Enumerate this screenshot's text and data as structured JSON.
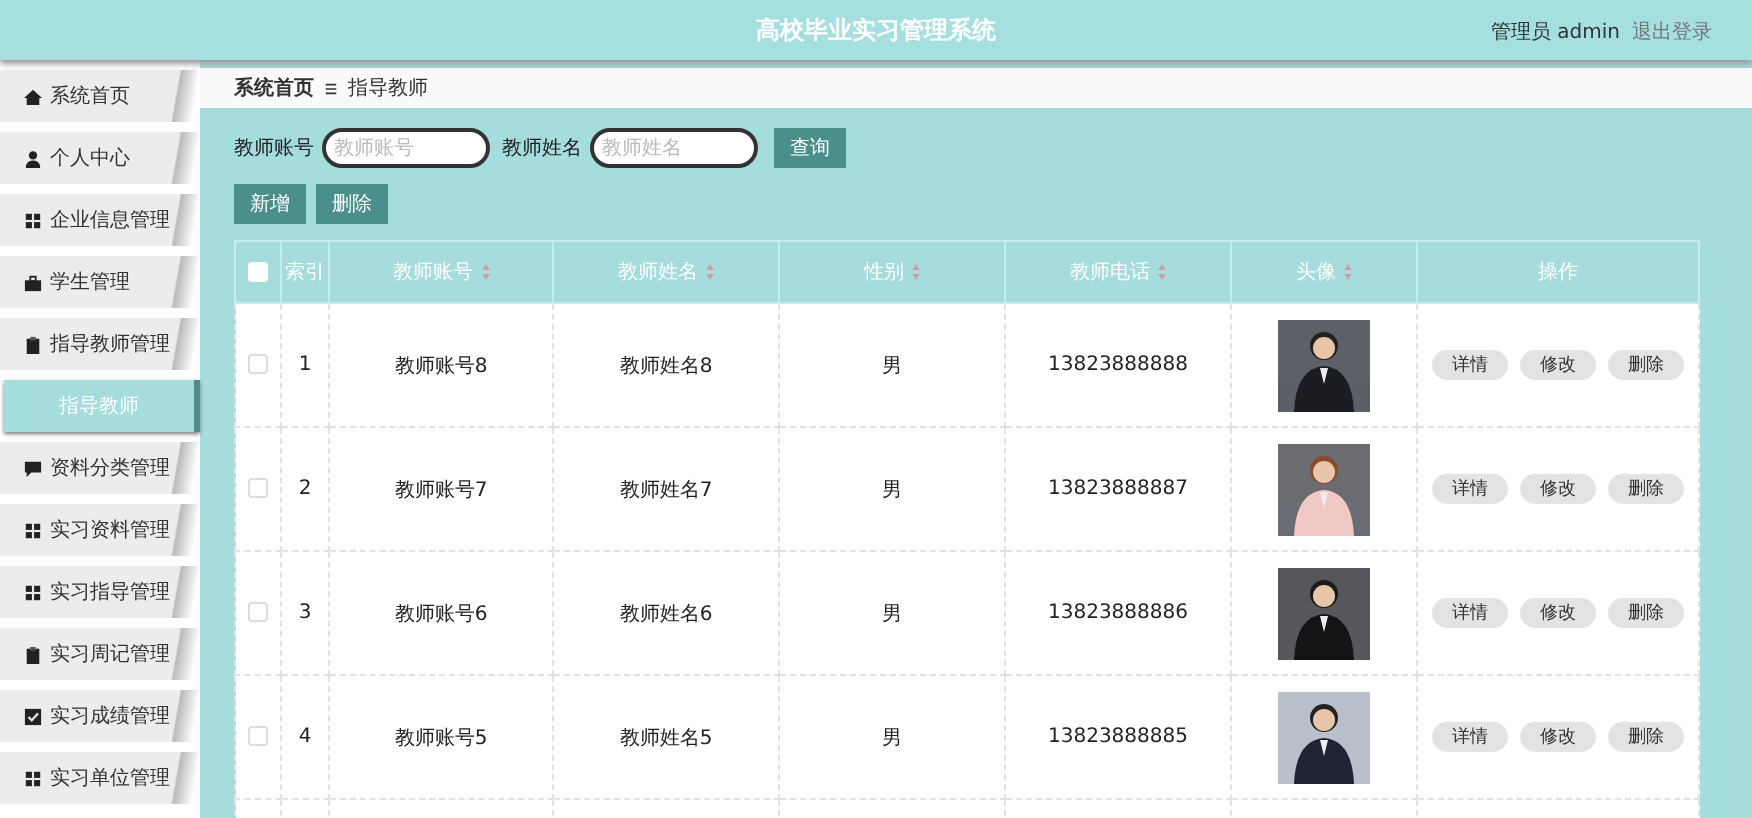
{
  "header": {
    "title": "高校毕业实习管理系统",
    "user": "管理员 admin",
    "logout": "退出登录"
  },
  "sidebar": {
    "items": [
      {
        "label": "系统首页",
        "kind": "menu",
        "selected": false
      },
      {
        "label": "个人中心",
        "kind": "menu",
        "selected": false
      },
      {
        "label": "企业信息管理",
        "kind": "menu",
        "selected": false
      },
      {
        "label": "学生管理",
        "kind": "menu",
        "selected": false
      },
      {
        "label": "指导教师管理",
        "kind": "menu",
        "selected": false
      },
      {
        "label": "指导教师",
        "kind": "submenu",
        "selected": true
      },
      {
        "label": "资料分类管理",
        "kind": "menu",
        "selected": false
      },
      {
        "label": "实习资料管理",
        "kind": "menu",
        "selected": false
      },
      {
        "label": "实习指导管理",
        "kind": "menu",
        "selected": false
      },
      {
        "label": "实习周记管理",
        "kind": "menu",
        "selected": false
      },
      {
        "label": "实习成绩管理",
        "kind": "menu",
        "selected": false
      },
      {
        "label": "实习单位管理",
        "kind": "menu",
        "selected": false
      }
    ]
  },
  "breadcrumb": [
    "系统首页",
    "指导教师"
  ],
  "search": {
    "fields": [
      {
        "label": "教师账号",
        "placeholder": "教师账号"
      },
      {
        "label": "教师姓名",
        "placeholder": "教师姓名"
      }
    ],
    "button": "查询"
  },
  "actions": [
    "新增",
    "删除"
  ],
  "table": {
    "select_all_checked": false,
    "columns": [
      {
        "label": "索引",
        "sortable": false
      },
      {
        "label": "教师账号",
        "sortable": true
      },
      {
        "label": "教师姓名",
        "sortable": true
      },
      {
        "label": "性别",
        "sortable": true
      },
      {
        "label": "教师电话",
        "sortable": true
      },
      {
        "label": "头像",
        "sortable": true
      },
      {
        "label": "操作",
        "sortable": false
      }
    ],
    "rows": [
      {
        "checked": false,
        "index": "1",
        "account": "教师账号8",
        "name": "教师姓名8",
        "gender": "男",
        "phone": "13823888888",
        "buttons": [
          "详情",
          "修改",
          "删除"
        ]
      },
      {
        "checked": false,
        "index": "2",
        "account": "教师账号7",
        "name": "教师姓名7",
        "gender": "男",
        "phone": "13823888887",
        "buttons": [
          "详情",
          "修改",
          "删除"
        ]
      },
      {
        "checked": false,
        "index": "3",
        "account": "教师账号6",
        "name": "教师姓名6",
        "gender": "男",
        "phone": "13823888886",
        "buttons": [
          "详情",
          "修改",
          "删除"
        ]
      },
      {
        "checked": false,
        "index": "4",
        "account": "教师账号5",
        "name": "教师姓名5",
        "gender": "男",
        "phone": "13823888885",
        "buttons": [
          "详情",
          "修改",
          "删除"
        ]
      }
    ]
  }
}
